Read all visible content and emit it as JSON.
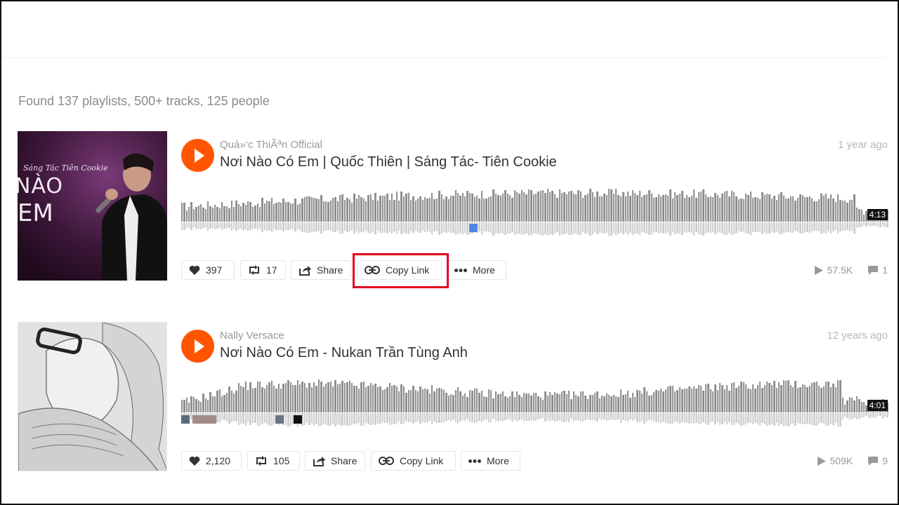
{
  "results": {
    "summary": "Found 137 playlists, 500+ tracks, 125 people"
  },
  "tracks": [
    {
      "uploader": "Quá»‘c ThiÃªn Official",
      "title": "Nơi Nào Có Em | Quốc Thiên | Sáng Tác- Tiên Cookie",
      "posted": "1 year ago",
      "duration": "4:13",
      "likes": "397",
      "reposts": "17",
      "share_label": "Share",
      "copy_link_label": "Copy Link",
      "more_label": "More",
      "plays": "57.5K",
      "comments": "1",
      "artwork_caption": "NÀO EM",
      "artwork_script": "Sáng Tác Tiên Cookie",
      "highlighted": true
    },
    {
      "uploader": "Nally Versace",
      "title": "Nơi Nào Có Em - Nukan Trần Tùng Anh",
      "posted": "12 years ago",
      "duration": "4:01",
      "likes": "2,120",
      "reposts": "105",
      "share_label": "Share",
      "copy_link_label": "Copy Link",
      "more_label": "More",
      "plays": "509K",
      "comments": "9",
      "highlighted": false
    }
  ],
  "colors": {
    "accent": "#ff5500",
    "highlight": "#e0001b",
    "waveform": "#8f8f8f"
  },
  "icons": [
    "play-icon",
    "heart-icon",
    "repost-icon",
    "share-icon",
    "link-icon",
    "more-icon",
    "plays-icon",
    "comment-icon"
  ]
}
